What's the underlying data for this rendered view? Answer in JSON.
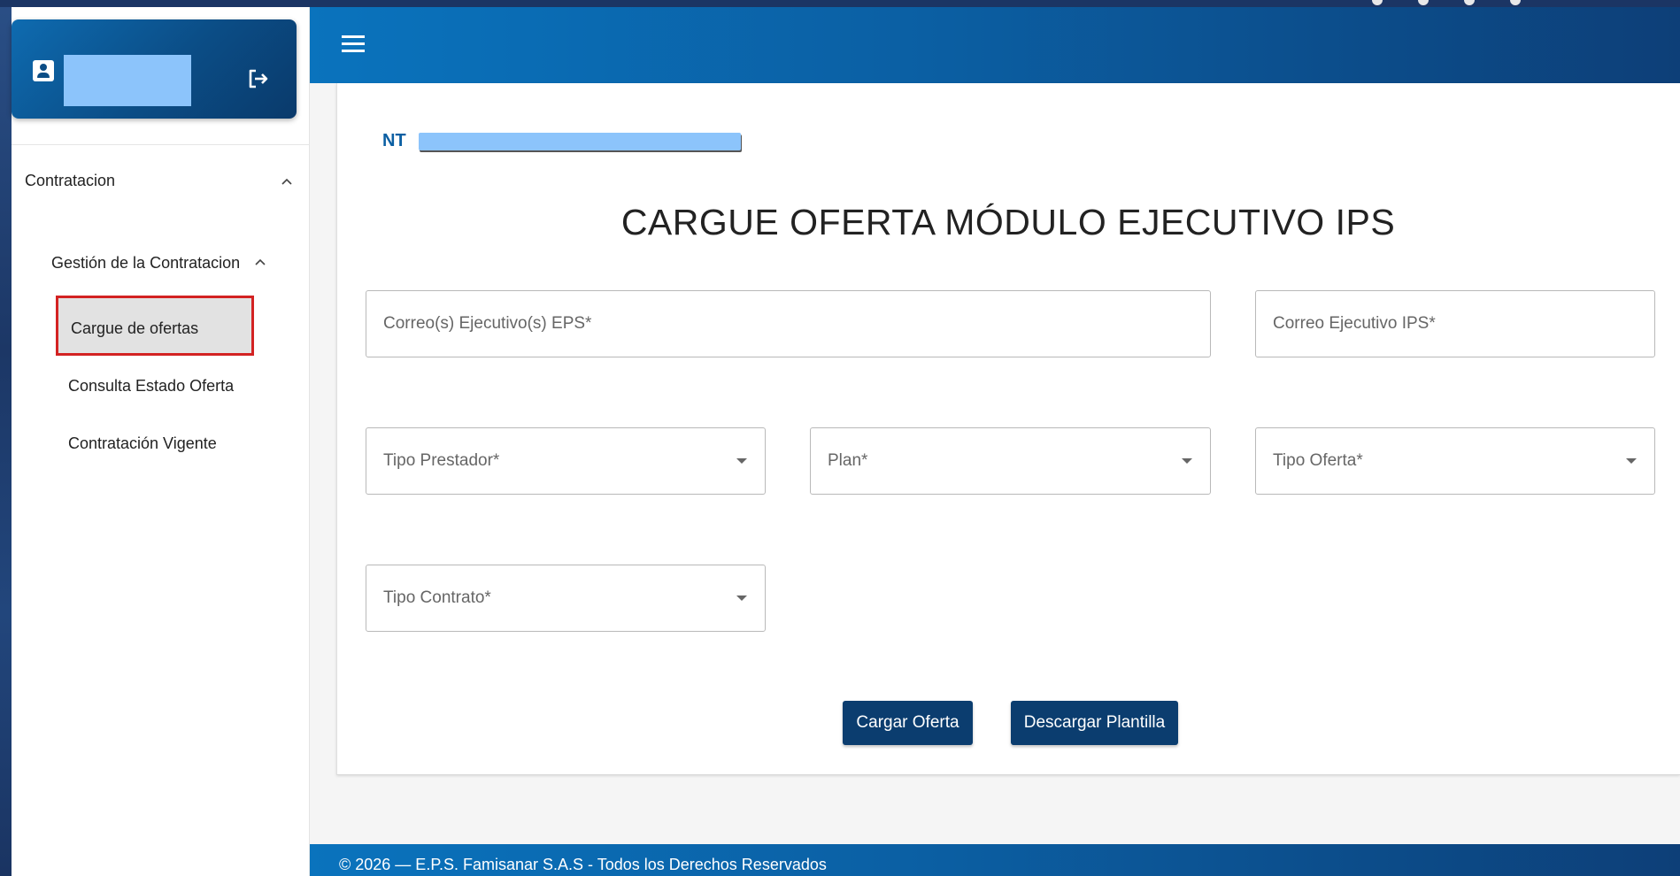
{
  "sidebar": {
    "section_label": "Contratacion",
    "subsection_label": "Gestión de la Contratacion",
    "items": [
      {
        "label": "Cargue de ofertas"
      },
      {
        "label": "Consulta Estado Oferta"
      },
      {
        "label": "Contratación Vigente"
      }
    ]
  },
  "header": {
    "nt_label": "NT"
  },
  "main": {
    "title": "CARGUE OFERTA MÓDULO EJECUTIVO IPS",
    "fields": {
      "eps_emails": "Correo(s) Ejecutivo(s) EPS*",
      "ips_email": "Correo Ejecutivo IPS*",
      "tipo_prestador": "Tipo Prestador*",
      "plan": "Plan*",
      "tipo_oferta": "Tipo Oferta*",
      "tipo_contrato": "Tipo Contrato*"
    },
    "buttons": {
      "cargar": "Cargar Oferta",
      "descargar": "Descargar Plantilla"
    }
  },
  "footer": {
    "text": "© 2026 — E.P.S. Famisanar S.A.S - Todos los Derechos Reservados"
  },
  "colors": {
    "primary": "#0b5fa3",
    "button": "#0b3d6f",
    "highlight_border": "#d32222",
    "redaction": "#8cc4fb"
  },
  "icons": [
    "user-icon",
    "logout-icon",
    "menu-icon",
    "chevron-up-icon",
    "caret-down-icon"
  ]
}
